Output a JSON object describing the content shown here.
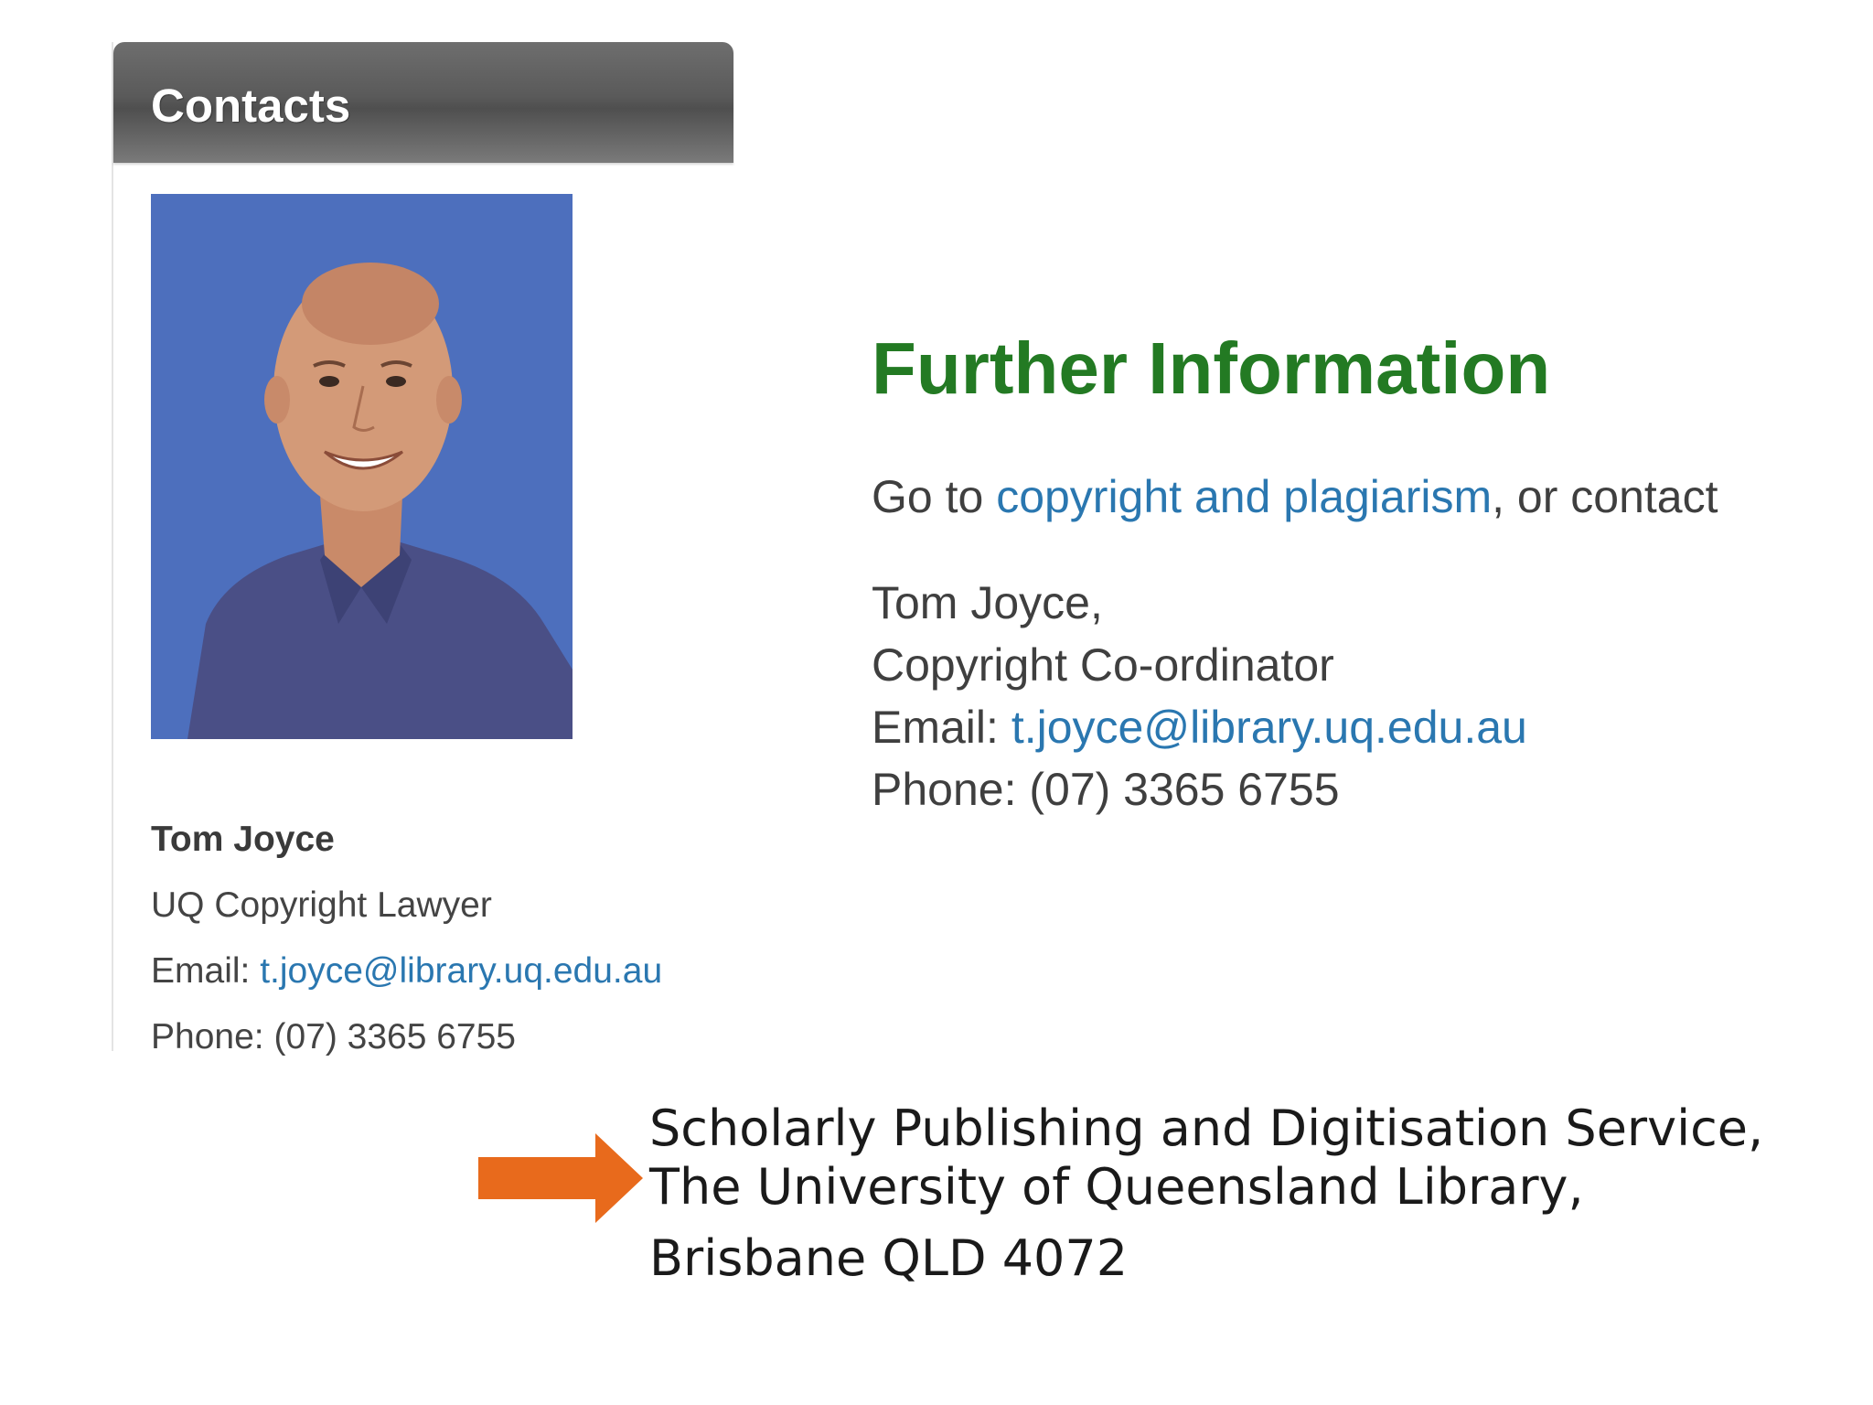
{
  "contacts_panel": {
    "header_title": "Contacts",
    "name": "Tom Joyce",
    "role": "UQ Copyright Lawyer",
    "email_label": "Email: ",
    "email": "t.joyce@library.uq.edu.au",
    "phone_label": "Phone: ",
    "phone": "(07) 3365 6755"
  },
  "further_info": {
    "title": "Further Information",
    "intro_prefix": "Go to ",
    "intro_link": "copyright and plagiarism",
    "intro_suffix": ", or contact",
    "name": "Tom Joyce,",
    "role": "Copyright Co-ordinator",
    "email_label": "Email: ",
    "email": "t.joyce@library.uq.edu.au",
    "phone_label": "Phone: ",
    "phone": "(07) 3365 6755"
  },
  "address": {
    "line1": "Scholarly Publishing and Digitisation Service,",
    "line2": "The University of Queensland Library,",
    "line3": "Brisbane QLD 4072"
  },
  "colors": {
    "header_gradient": "#5a5a5a",
    "title_green": "#237a23",
    "link_blue": "#2a77b0",
    "arrow_orange": "#e86a1c",
    "photo_background": "#4d6fbd"
  },
  "icons": {
    "arrow": "arrow-right-icon",
    "photo": "person-photo"
  }
}
